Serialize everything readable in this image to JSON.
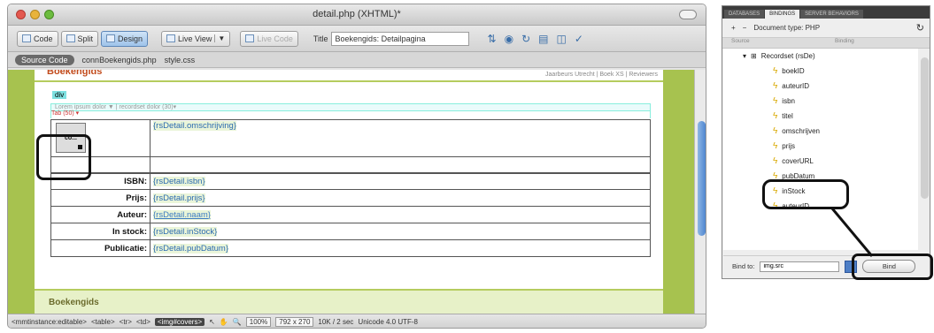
{
  "window": {
    "title": "detail.php (XHTML)*"
  },
  "toolbar": {
    "code": "Code",
    "split": "Split",
    "design": "Design",
    "live_view": "Live View",
    "live_code": "Live Code",
    "title_label": "Title",
    "title_value": "Boekengids: Detailpagina"
  },
  "related": {
    "source": "Source Code",
    "file1": "connBoekengids.php",
    "file2": "style.css"
  },
  "design": {
    "brand_top": "Boekengids",
    "top_links": "Jaarbeurs Utrecht | Boek XS | Reviewers",
    "div_tag": "div",
    "cyan_row": "Lorem ipsum dolor  ▼  |   recordset dolor   (30)▾",
    "cyan_row2": "                   Tab (50)   ▾",
    "image_placeholder": "co...",
    "rows": [
      {
        "label": "",
        "value": "{rsDetail.omschrijving}"
      },
      {
        "label": "ISBN:",
        "value": "{rsDetail.isbn}"
      },
      {
        "label": "Prijs:",
        "value": "{rsDetail.prijs}"
      },
      {
        "label": "Auteur:",
        "value": "{rsDetail.naam}"
      },
      {
        "label": "In stock:",
        "value": "{rsDetail.inStock}"
      },
      {
        "label": "Publicatie:",
        "value": "{rsDetail.pubDatum}"
      }
    ],
    "footer": "Boekengids"
  },
  "status": {
    "tags": [
      "<mmtinstance:editable>",
      "<table>",
      "<tr>",
      "<td>"
    ],
    "selected_tag": "<img#covers>",
    "zoom": "100%",
    "size": "792 x 270",
    "weight": "10K / 2 sec",
    "encoding": "Unicode 4.0 UTF-8"
  },
  "panel": {
    "tabs": [
      "DATABASES",
      "BINDINGS",
      "SERVER BEHAVIORS"
    ],
    "doc_type": "Document type: PHP",
    "col_source": "Source",
    "col_binding": "Binding",
    "recordset": "Recordset (rsDe)",
    "fields": [
      "boekID",
      "auteurID",
      "isbn",
      "titel",
      "omschrijven",
      "prijs",
      "coverURL",
      "pubDatum",
      "inStock",
      "auteurID"
    ],
    "bind_to_label": "Bind to:",
    "bind_to_value": "img.src",
    "bind_button": "Bind"
  }
}
